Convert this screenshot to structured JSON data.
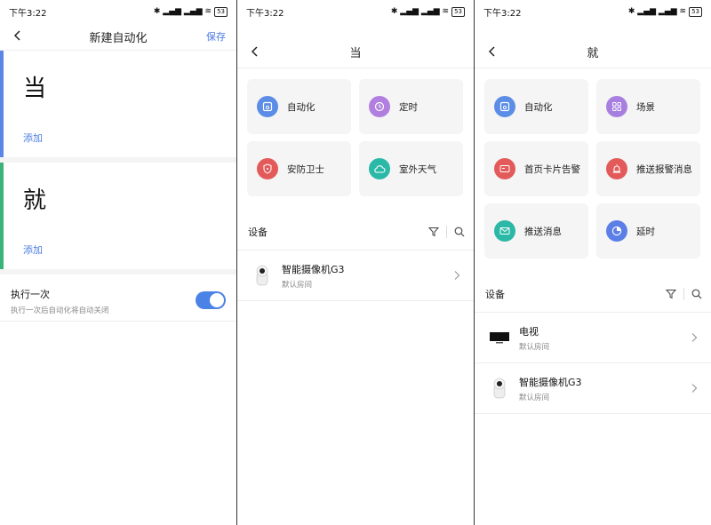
{
  "status_time": "下午3:22",
  "status_icons": "✱ ▂▄▆ ▂▄▆ ≋",
  "battery": "53",
  "panel1": {
    "title": "新建自动化",
    "save": "保存",
    "when_label": "当",
    "then_label": "就",
    "add1": "添加",
    "add2": "添加",
    "once_title": "执行一次",
    "once_desc": "执行一次后自动化将自动关闭",
    "colors": {
      "when_bar": "#5b86e5",
      "then_bar": "#3ab37a",
      "toggle": "#4a82e6"
    }
  },
  "panel2": {
    "title": "当",
    "tiles": [
      {
        "label": "自动化",
        "icon": "automation-icon",
        "color": "#5b8de6"
      },
      {
        "label": "定时",
        "icon": "clock-icon",
        "color": "#b07fe0"
      },
      {
        "label": "安防卫士",
        "icon": "shield-icon",
        "color": "#e35a5a"
      },
      {
        "label": "室外天气",
        "icon": "cloud-icon",
        "color": "#2bb8a6"
      }
    ],
    "devices_label": "设备",
    "devices": [
      {
        "name": "智能摄像机G3",
        "room": "默认房间",
        "icon": "camera-icon"
      }
    ]
  },
  "panel3": {
    "title": "就",
    "tiles": [
      {
        "label": "自动化",
        "icon": "automation-icon",
        "color": "#5b8de6"
      },
      {
        "label": "场景",
        "icon": "grid-icon",
        "color": "#a77fe0"
      },
      {
        "label": "首页卡片告警",
        "icon": "card-icon",
        "color": "#e35a5a"
      },
      {
        "label": "推送报警消息",
        "icon": "alarm-icon",
        "color": "#e35a5a"
      },
      {
        "label": "推送消息",
        "icon": "mail-icon",
        "color": "#2bb8a6"
      },
      {
        "label": "延时",
        "icon": "timer-icon",
        "color": "#5b7fe6"
      }
    ],
    "devices_label": "设备",
    "devices": [
      {
        "name": "电视",
        "room": "默认房间",
        "icon": "tv-icon"
      },
      {
        "name": "智能摄像机G3",
        "room": "默认房间",
        "icon": "camera-icon"
      }
    ]
  }
}
